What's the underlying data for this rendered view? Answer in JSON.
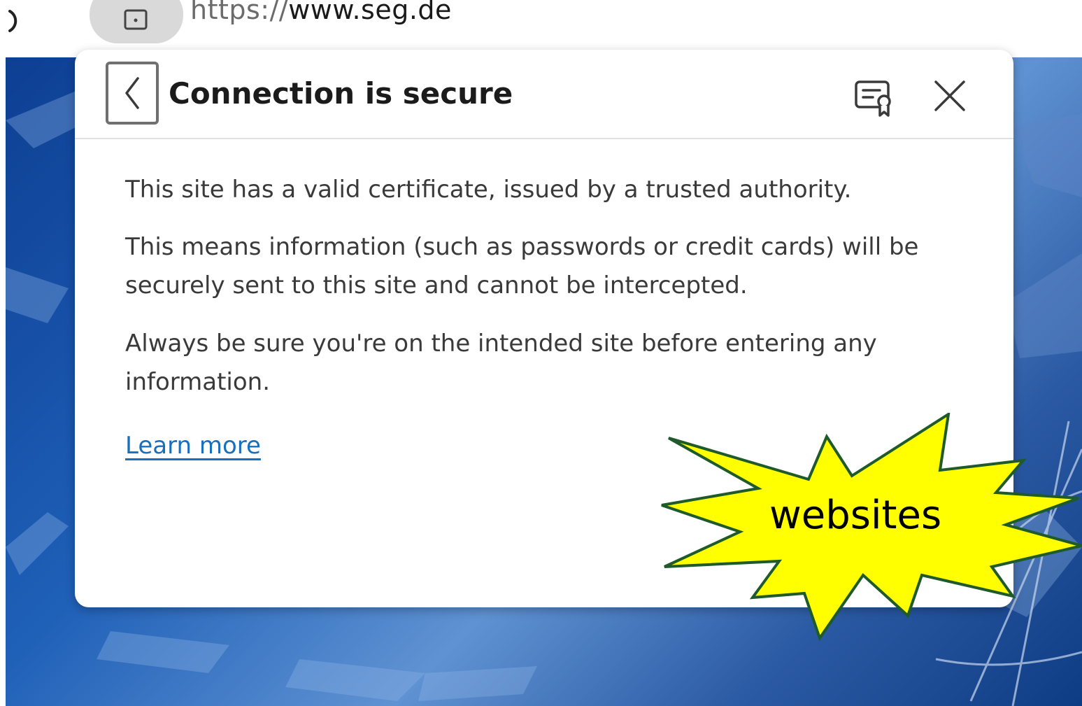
{
  "browser": {
    "url_scheme": "https://",
    "url_host": "www.seg.de"
  },
  "popup": {
    "title": "Connection is secure",
    "paragraphs": [
      "This site has a valid certificate, issued by a trusted authority.",
      "This means information (such as passwords or credit cards) will be securely sent to this site and cannot be intercepted.",
      "Always be sure you're on the intended site before entering any information."
    ],
    "learn_more": "Learn more",
    "icons": {
      "back": "chevron-left-icon",
      "certificate": "certificate-icon",
      "close": "close-icon"
    }
  },
  "callout": {
    "label": "websites",
    "fill_color": "#ffff00",
    "stroke_color": "#1e5a2a"
  }
}
